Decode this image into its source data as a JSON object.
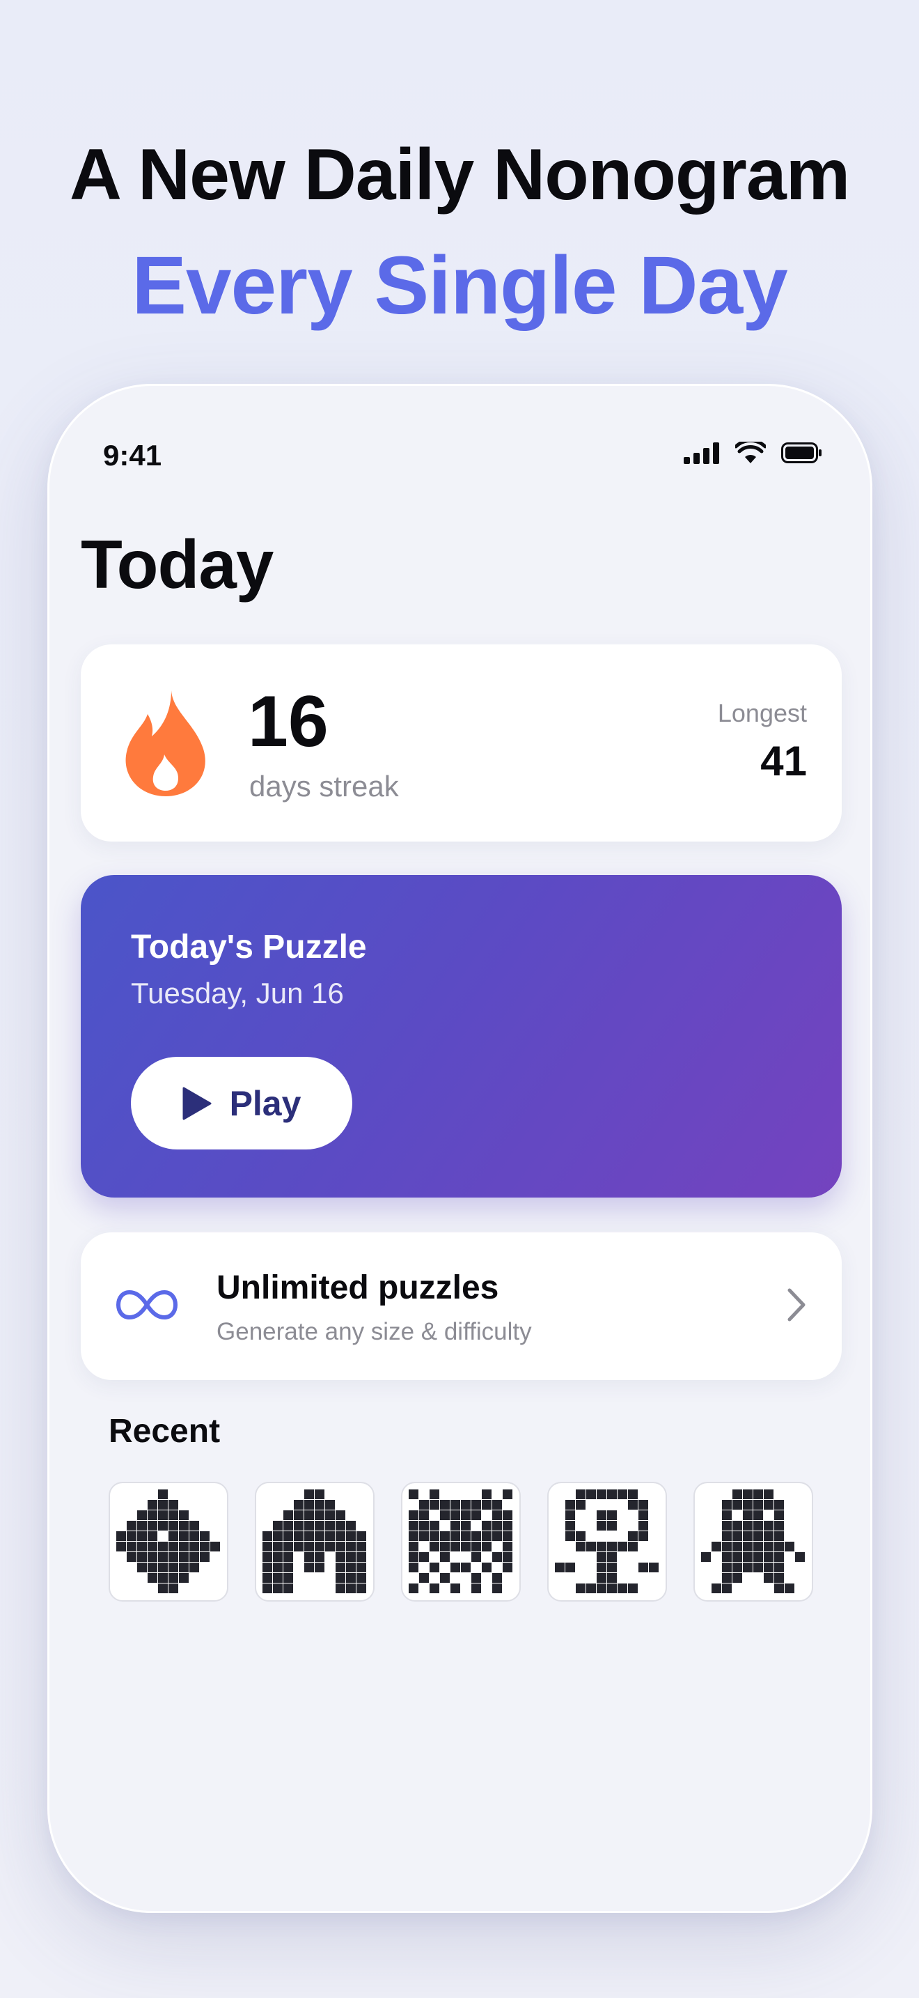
{
  "headline": {
    "line1": "A New Daily Nonogram",
    "line2": "Every Single Day"
  },
  "status_bar": {
    "time": "9:41",
    "icons": [
      "cellular-signal-icon",
      "wifi-icon",
      "battery-icon"
    ]
  },
  "page_title": "Today",
  "streak": {
    "value": "16",
    "label": "days streak",
    "longest_label": "Longest",
    "longest_value": "41",
    "icon": "flame-icon"
  },
  "todays_puzzle": {
    "title": "Today's Puzzle",
    "date": "Tuesday, Jun 16",
    "play_label": "Play"
  },
  "unlimited": {
    "title": "Unlimited puzzles",
    "subtitle": "Generate any size & difficulty",
    "icon": "infinity-icon"
  },
  "recent": {
    "title": "Recent",
    "puzzles": [
      {
        "name": "recent-puzzle-fish",
        "grid": [
          "....#.....",
          "...###....",
          "..#####...",
          ".#######..",
          "####.####.",
          "##########",
          ".########.",
          "..######..",
          "...####...",
          "....##...."
        ]
      },
      {
        "name": "recent-puzzle-house",
        "grid": [
          "....##....",
          "...####...",
          "..######..",
          ".########.",
          "##########",
          "##########",
          "###.##.###",
          "###.##.###",
          "###....###",
          "###....###"
        ]
      },
      {
        "name": "recent-puzzle-invader",
        "grid": [
          "#.#....#.#",
          ".########.",
          "##.####.##",
          "###.##.###",
          "##########",
          "#.######.#",
          "##.#..#.##",
          "#.#.##.#.#",
          ".#.#..#.#.",
          "#.#.#.#.#."
        ]
      },
      {
        "name": "recent-puzzle-flower",
        "grid": [
          "..######..",
          ".##....##.",
          ".#..##..#.",
          ".#..##..#.",
          ".##....##.",
          "..######..",
          "....##....",
          "##..##..##",
          "....##....",
          "..######.."
        ]
      },
      {
        "name": "recent-puzzle-robot",
        "grid": [
          "...####...",
          "..######..",
          "..#.##.#..",
          "..######..",
          "..######..",
          ".########.",
          "#.######.#",
          "..######..",
          "..##..##..",
          ".##....##."
        ]
      }
    ]
  },
  "colors": {
    "accent": "#5b6ae8",
    "flame": "#ff7a3d",
    "play_text": "#2c2f7a",
    "puzzle_gradient_start": "#4b55c9",
    "puzzle_gradient_end": "#7443bf",
    "pixel": "#24252d"
  }
}
